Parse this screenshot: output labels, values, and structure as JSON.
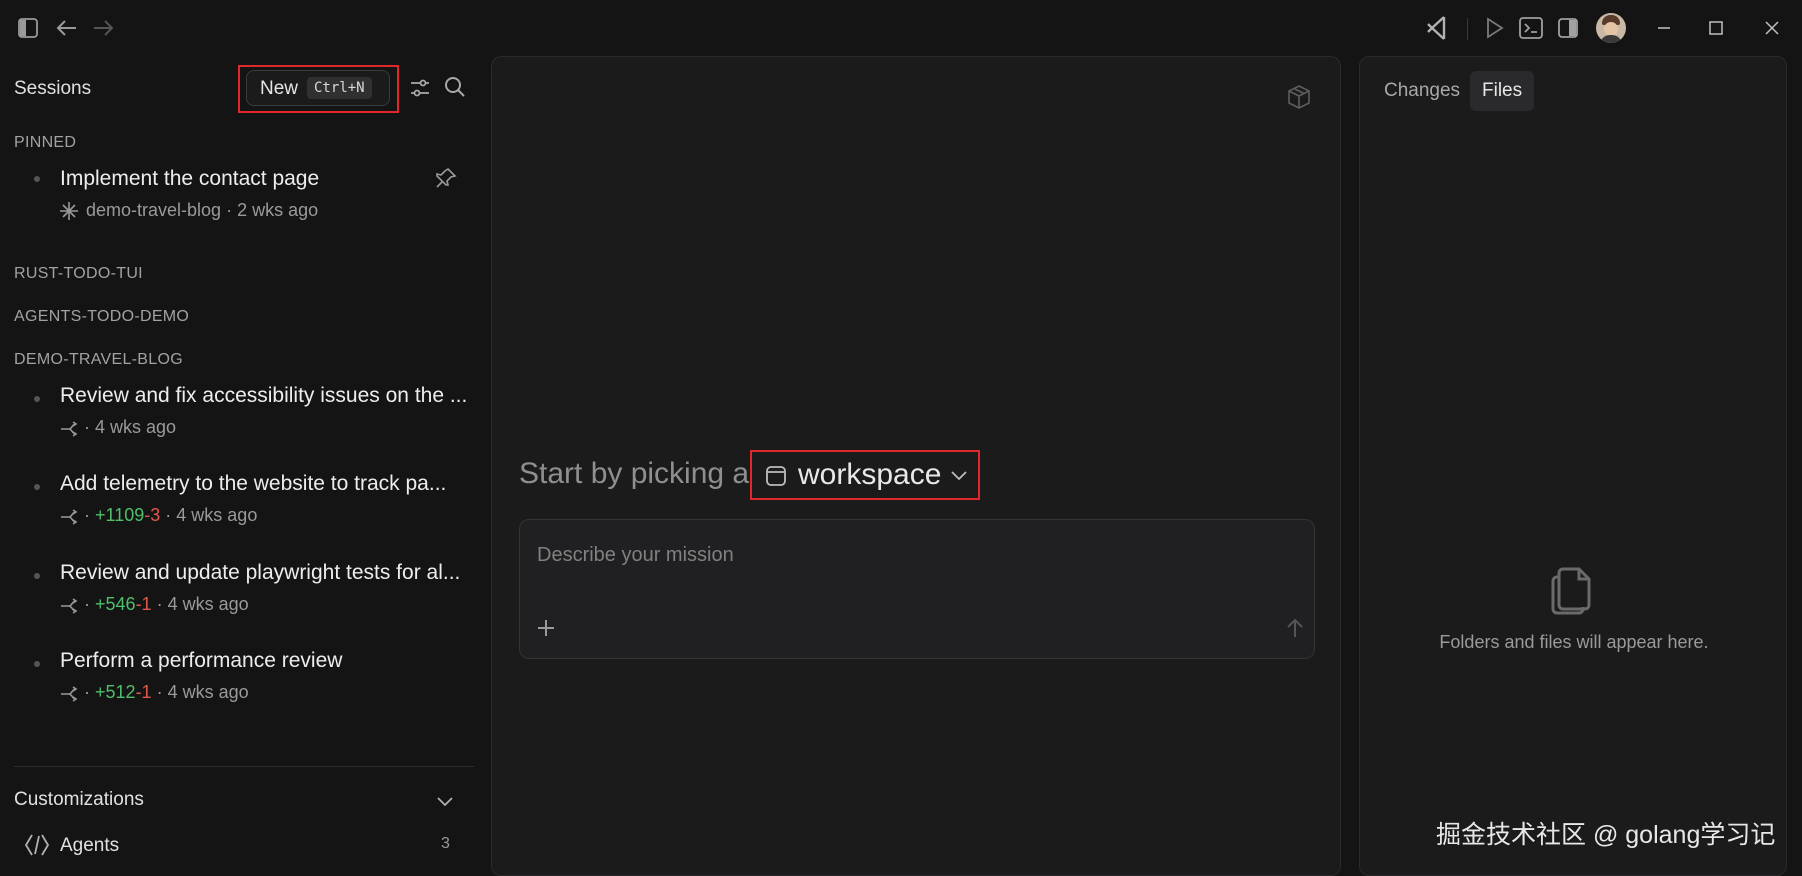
{
  "sidebar": {
    "title": "Sessions",
    "new_button": {
      "label": "New",
      "shortcut": "Ctrl+N"
    },
    "pinned_header": "PINNED",
    "pinned": [
      {
        "title": "Implement the contact page",
        "repo": "demo-travel-blog",
        "sep": "·",
        "time": "2 wks ago"
      }
    ],
    "groups": [
      "RUST-TODO-TUI",
      "AGENTS-TODO-DEMO",
      "DEMO-TRAVEL-BLOG"
    ],
    "sessions": [
      {
        "title": "Review and fix accessibility issues on the ...",
        "sep1": "·",
        "added": "",
        "removed": "",
        "sep2": "",
        "time": "4 wks ago"
      },
      {
        "title": "Add telemetry to the website to track pa...",
        "sep1": "·",
        "added": "+1109",
        "removed": "-3",
        "sep2": "·",
        "time": "4 wks ago"
      },
      {
        "title": "Review and update playwright tests for al...",
        "sep1": "·",
        "added": "+546",
        "removed": "-1",
        "sep2": "·",
        "time": "4 wks ago"
      },
      {
        "title": "Perform a performance review",
        "sep1": "·",
        "added": "+512",
        "removed": "-1",
        "sep2": "·",
        "time": "4 wks ago"
      }
    ],
    "customizations_title": "Customizations",
    "agents": {
      "label": "Agents",
      "count": "3"
    }
  },
  "center": {
    "prompt_prefix": "Start by picking a",
    "workspace_label": "workspace",
    "mission_placeholder": "Describe your mission"
  },
  "right": {
    "tabs": {
      "changes": "Changes",
      "files": "Files"
    },
    "empty_message": "Folders and files will appear here."
  },
  "watermark": "掘金技术社区 @ golang学习记",
  "colors": {
    "background": "#141415",
    "panel": "#1b1b1c",
    "highlight": "#e0282c",
    "added": "#4fbf6c",
    "removed": "#e0574f"
  }
}
